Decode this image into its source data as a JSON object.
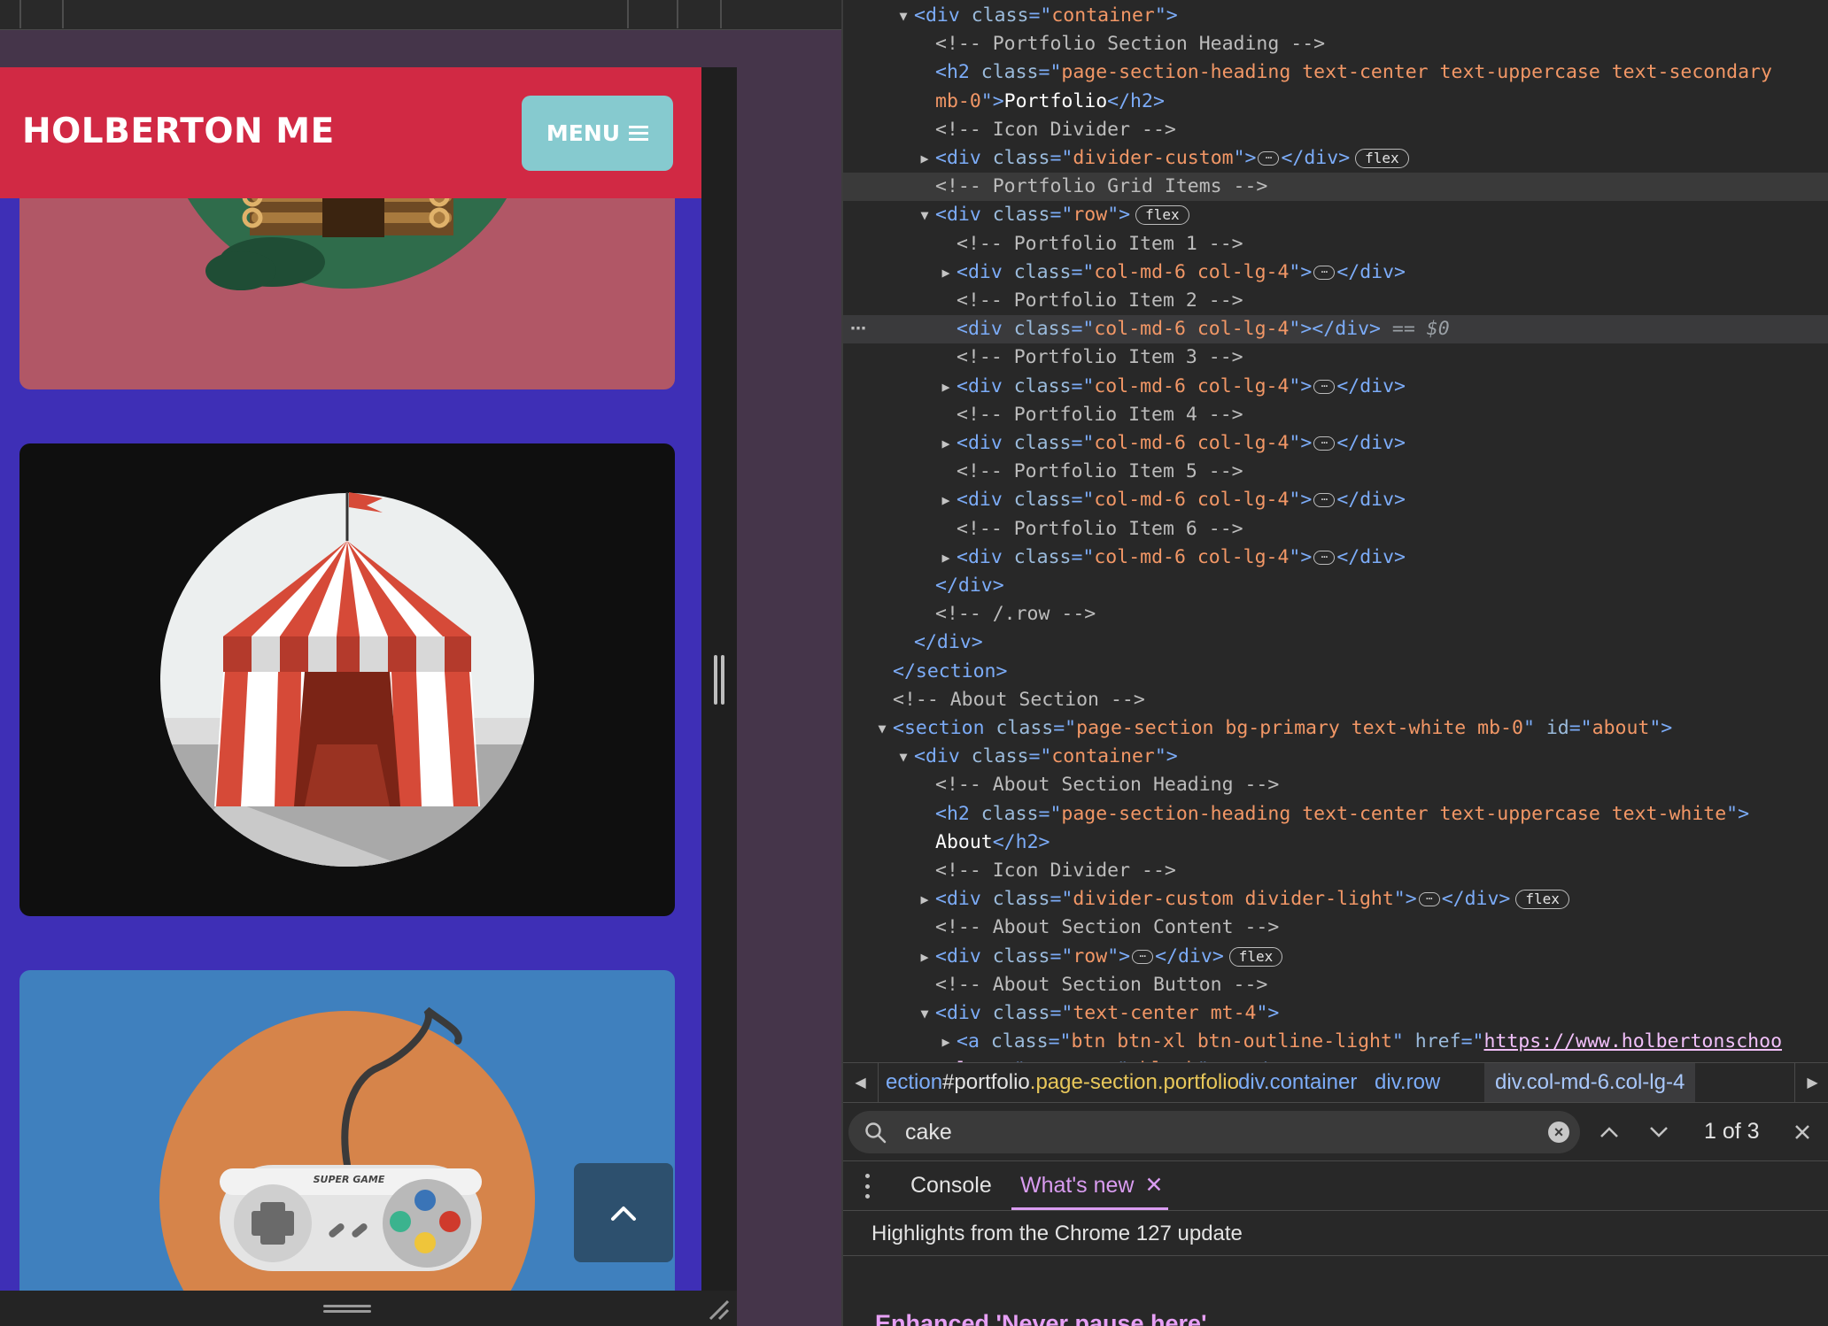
{
  "site": {
    "brand": "HOLBERTON ME",
    "menu_label": "MENU",
    "menu_icon": "hamburger-icon",
    "scroll_top_icon": "chevron-up-icon",
    "colors": {
      "navbar": "#d12944",
      "menu_button": "#86cacf",
      "page_background": "#3e2fb6",
      "card_cabin": "#b15766",
      "card_circus": "#0f0f0f",
      "card_game": "#3f80be",
      "scroll_top_button": "#2d506e"
    },
    "controller_label": "SUPER GAME"
  },
  "dom": {
    "lines": [
      {
        "indent": 0,
        "toggle": "open",
        "parts": [
          [
            "tag",
            "<div "
          ],
          [
            "attr",
            "class"
          ],
          [
            "tag",
            "=\""
          ],
          [
            "aval",
            "container"
          ],
          [
            "tag",
            "\">"
          ]
        ]
      },
      {
        "indent": 1,
        "parts": [
          [
            "cmt",
            "<!-- Portfolio Section Heading -->"
          ]
        ]
      },
      {
        "indent": 1,
        "parts": [
          [
            "tag",
            "<h2 "
          ],
          [
            "attr",
            "class"
          ],
          [
            "tag",
            "=\""
          ],
          [
            "aval",
            "page-section-heading text-center text-uppercase text-secondary"
          ]
        ]
      },
      {
        "indent": 1,
        "parts": [
          [
            "aval",
            "mb-0"
          ],
          [
            "tag",
            "\">"
          ],
          [
            "txt",
            "Portfolio"
          ],
          [
            "tag",
            "</h2>"
          ]
        ]
      },
      {
        "indent": 1,
        "parts": [
          [
            "cmt",
            "<!-- Icon Divider -->"
          ]
        ]
      },
      {
        "indent": 1,
        "toggle": "closed",
        "parts": [
          [
            "tag",
            "<div "
          ],
          [
            "attr",
            "class"
          ],
          [
            "tag",
            "=\""
          ],
          [
            "aval",
            "divider-custom"
          ],
          [
            "tag",
            "\">"
          ],
          [
            "ell",
            "⋯"
          ],
          [
            "tag",
            "</div>"
          ]
        ],
        "badge": "flex"
      },
      {
        "indent": 1,
        "hl": true,
        "parts": [
          [
            "cmt",
            "<!-- Portfolio Grid Items -->"
          ]
        ]
      },
      {
        "indent": 1,
        "toggle": "open",
        "parts": [
          [
            "tag",
            "<div "
          ],
          [
            "attr",
            "class"
          ],
          [
            "tag",
            "=\""
          ],
          [
            "aval",
            "row"
          ],
          [
            "tag",
            "\">"
          ]
        ],
        "badge": "flex"
      },
      {
        "indent": 2,
        "parts": [
          [
            "cmt",
            "<!-- Portfolio Item 1 -->"
          ]
        ]
      },
      {
        "indent": 2,
        "toggle": "closed",
        "parts": [
          [
            "tag",
            "<div "
          ],
          [
            "attr",
            "class"
          ],
          [
            "tag",
            "=\""
          ],
          [
            "aval",
            "col-md-6 col-lg-4"
          ],
          [
            "tag",
            "\">"
          ],
          [
            "ell",
            "⋯"
          ],
          [
            "tag",
            "</div>"
          ]
        ]
      },
      {
        "indent": 2,
        "parts": [
          [
            "cmt",
            "<!-- Portfolio Item 2 -->"
          ]
        ]
      },
      {
        "indent": 2,
        "sel": true,
        "dots": "⋯",
        "parts": [
          [
            "tag",
            "<div "
          ],
          [
            "attr",
            "class"
          ],
          [
            "tag",
            "=\""
          ],
          [
            "aval",
            "col-md-6 col-lg-4"
          ],
          [
            "tag",
            "\"></div>"
          ],
          [
            "eq",
            " == "
          ],
          [
            "dollar",
            "$0"
          ]
        ]
      },
      {
        "indent": 2,
        "parts": [
          [
            "cmt",
            "<!-- Portfolio Item 3 -->"
          ]
        ]
      },
      {
        "indent": 2,
        "toggle": "closed",
        "parts": [
          [
            "tag",
            "<div "
          ],
          [
            "attr",
            "class"
          ],
          [
            "tag",
            "=\""
          ],
          [
            "aval",
            "col-md-6 col-lg-4"
          ],
          [
            "tag",
            "\">"
          ],
          [
            "ell",
            "⋯"
          ],
          [
            "tag",
            "</div>"
          ]
        ]
      },
      {
        "indent": 2,
        "parts": [
          [
            "cmt",
            "<!-- Portfolio Item 4 -->"
          ]
        ]
      },
      {
        "indent": 2,
        "toggle": "closed",
        "parts": [
          [
            "tag",
            "<div "
          ],
          [
            "attr",
            "class"
          ],
          [
            "tag",
            "=\""
          ],
          [
            "aval",
            "col-md-6 col-lg-4"
          ],
          [
            "tag",
            "\">"
          ],
          [
            "ell",
            "⋯"
          ],
          [
            "tag",
            "</div>"
          ]
        ]
      },
      {
        "indent": 2,
        "parts": [
          [
            "cmt",
            "<!-- Portfolio Item 5 -->"
          ]
        ]
      },
      {
        "indent": 2,
        "toggle": "closed",
        "parts": [
          [
            "tag",
            "<div "
          ],
          [
            "attr",
            "class"
          ],
          [
            "tag",
            "=\""
          ],
          [
            "aval",
            "col-md-6 col-lg-4"
          ],
          [
            "tag",
            "\">"
          ],
          [
            "ell",
            "⋯"
          ],
          [
            "tag",
            "</div>"
          ]
        ]
      },
      {
        "indent": 2,
        "parts": [
          [
            "cmt",
            "<!-- Portfolio Item 6 -->"
          ]
        ]
      },
      {
        "indent": 2,
        "toggle": "closed",
        "parts": [
          [
            "tag",
            "<div "
          ],
          [
            "attr",
            "class"
          ],
          [
            "tag",
            "=\""
          ],
          [
            "aval",
            "col-md-6 col-lg-4"
          ],
          [
            "tag",
            "\">"
          ],
          [
            "ell",
            "⋯"
          ],
          [
            "tag",
            "</div>"
          ]
        ]
      },
      {
        "indent": 1,
        "parts": [
          [
            "tag",
            "</div>"
          ]
        ]
      },
      {
        "indent": 1,
        "parts": [
          [
            "cmt",
            "<!-- /.row -->"
          ]
        ]
      },
      {
        "indent": 0,
        "parts": [
          [
            "tag",
            "</div>"
          ]
        ]
      },
      {
        "indent": -1,
        "parts": [
          [
            "tag",
            "</section>"
          ]
        ]
      },
      {
        "indent": -1,
        "parts": [
          [
            "cmt",
            "<!-- About Section -->"
          ]
        ]
      },
      {
        "indent": -1,
        "toggle": "open",
        "parts": [
          [
            "tag",
            "<section "
          ],
          [
            "attr",
            "class"
          ],
          [
            "tag",
            "=\""
          ],
          [
            "aval",
            "page-section bg-primary text-white mb-0"
          ],
          [
            "tag",
            "\" "
          ],
          [
            "attr",
            "id"
          ],
          [
            "tag",
            "=\""
          ],
          [
            "aval",
            "about"
          ],
          [
            "tag",
            "\">"
          ]
        ]
      },
      {
        "indent": 0,
        "toggle": "open",
        "parts": [
          [
            "tag",
            "<div "
          ],
          [
            "attr",
            "class"
          ],
          [
            "tag",
            "=\""
          ],
          [
            "aval",
            "container"
          ],
          [
            "tag",
            "\">"
          ]
        ]
      },
      {
        "indent": 1,
        "parts": [
          [
            "cmt",
            "<!-- About Section Heading -->"
          ]
        ]
      },
      {
        "indent": 1,
        "parts": [
          [
            "tag",
            "<h2 "
          ],
          [
            "attr",
            "class"
          ],
          [
            "tag",
            "=\""
          ],
          [
            "aval",
            "page-section-heading text-center text-uppercase text-white"
          ],
          [
            "tag",
            "\">"
          ]
        ]
      },
      {
        "indent": 1,
        "parts": [
          [
            "txt",
            "About"
          ],
          [
            "tag",
            "</h2>"
          ]
        ]
      },
      {
        "indent": 1,
        "parts": [
          [
            "cmt",
            "<!-- Icon Divider -->"
          ]
        ]
      },
      {
        "indent": 1,
        "toggle": "closed",
        "parts": [
          [
            "tag",
            "<div "
          ],
          [
            "attr",
            "class"
          ],
          [
            "tag",
            "=\""
          ],
          [
            "aval",
            "divider-custom divider-light"
          ],
          [
            "tag",
            "\">"
          ],
          [
            "ell",
            "⋯"
          ],
          [
            "tag",
            "</div>"
          ]
        ],
        "badge": "flex"
      },
      {
        "indent": 1,
        "parts": [
          [
            "cmt",
            "<!-- About Section Content -->"
          ]
        ]
      },
      {
        "indent": 1,
        "toggle": "closed",
        "parts": [
          [
            "tag",
            "<div "
          ],
          [
            "attr",
            "class"
          ],
          [
            "tag",
            "=\""
          ],
          [
            "aval",
            "row"
          ],
          [
            "tag",
            "\">"
          ],
          [
            "ell",
            "⋯"
          ],
          [
            "tag",
            "</div>"
          ]
        ],
        "badge": "flex"
      },
      {
        "indent": 1,
        "parts": [
          [
            "cmt",
            "<!-- About Section Button -->"
          ]
        ]
      },
      {
        "indent": 1,
        "toggle": "open",
        "parts": [
          [
            "tag",
            "<div "
          ],
          [
            "attr",
            "class"
          ],
          [
            "tag",
            "=\""
          ],
          [
            "aval",
            "text-center mt-4"
          ],
          [
            "tag",
            "\">"
          ]
        ]
      },
      {
        "indent": 2,
        "toggle": "closed",
        "parts": [
          [
            "tag",
            "<a "
          ],
          [
            "attr",
            "class"
          ],
          [
            "tag",
            "=\""
          ],
          [
            "aval",
            "btn btn-xl btn-outline-light"
          ],
          [
            "tag",
            "\" "
          ],
          [
            "attr",
            "href"
          ],
          [
            "tag",
            "=\""
          ],
          [
            "link",
            "https://www.holbertonschoo"
          ]
        ]
      },
      {
        "indent": 2,
        "parts": [
          [
            "link",
            "l.com"
          ],
          [
            "tag",
            "\" "
          ],
          [
            "attr",
            "target"
          ],
          [
            "tag",
            "=\""
          ],
          [
            "aval",
            "_blank"
          ],
          [
            "tag",
            "\">"
          ],
          [
            "ell",
            "⋯"
          ],
          [
            "tag",
            "</a>"
          ]
        ]
      }
    ]
  },
  "breadcrumbs": [
    {
      "tag": "section",
      "hash": "#portfolio",
      "cls": ".page-section.portfolio",
      "clipped": "ection"
    },
    {
      "tag": "div",
      "cls": ".container"
    },
    {
      "tag": "div",
      "cls": ".row"
    },
    {
      "tag": "div",
      "cls": ".col-md-6.col-lg-4",
      "active": true
    }
  ],
  "search": {
    "value": "cake",
    "match_count": "1 of 3",
    "icon": "search-icon"
  },
  "drawer": {
    "tabs": [
      "Console",
      "What's new"
    ],
    "active_tab": "What's new",
    "whatsnew_heading": "Highlights from the Chrome 127 update",
    "feature_title": "Enhanced 'Never pause here'"
  }
}
